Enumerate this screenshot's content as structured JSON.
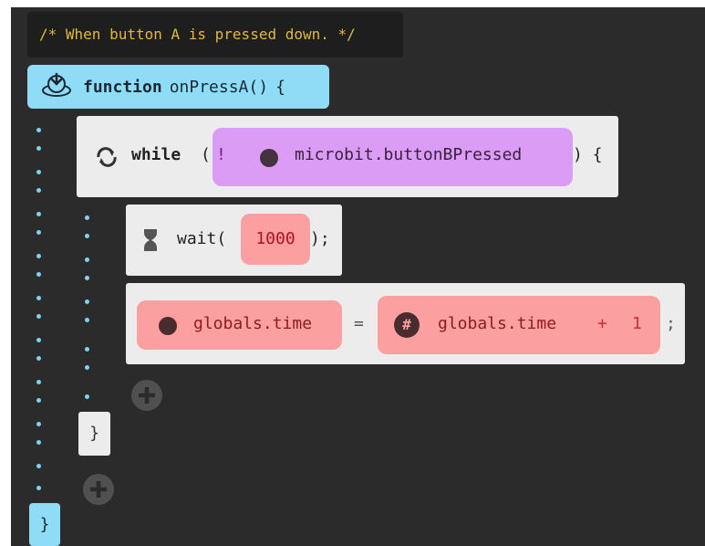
{
  "comment": "/* When button A is pressed down. */",
  "function": {
    "keyword": "function",
    "name": "onPressA()",
    "open": "{",
    "icon": "press-button-icon",
    "close": "}"
  },
  "while_block": {
    "keyword": "while",
    "open_paren": "(",
    "not": "!",
    "condition": "microbit.buttonBPressed",
    "close": ") {",
    "icon": "loop-icon",
    "end_brace": "}"
  },
  "wait_block": {
    "keyword": "wait(",
    "value": "1000",
    "close": ");",
    "icon": "hourglass-icon"
  },
  "assignment": {
    "target": "globals.time",
    "operator": "=",
    "source": "globals.time",
    "plus": "+",
    "increment": "1",
    "semicolon": ";",
    "number_icon": "#"
  },
  "icons": {
    "add": "plus-circle-icon"
  },
  "colors": {
    "editor_bg": "#2b2b2b",
    "function_block": "#8fdcf6",
    "boolean_expr": "#da9cf4",
    "number_expr": "#fb9fa1",
    "statement_block": "#ececec",
    "comment_text": "#e2b93b"
  }
}
